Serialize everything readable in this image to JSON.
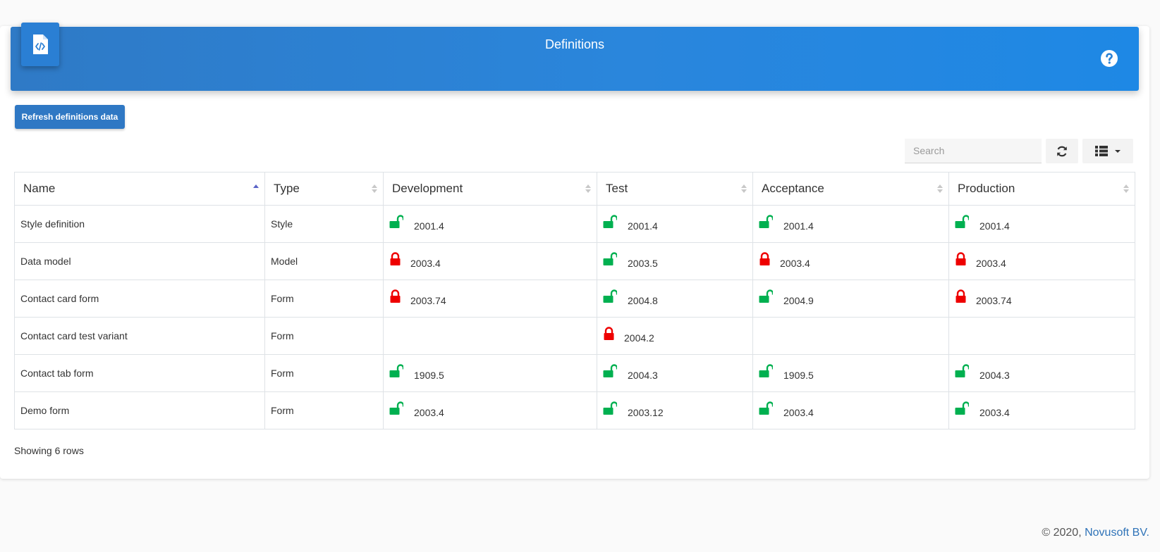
{
  "header": {
    "title": "Definitions",
    "app_icon": "code-file-icon",
    "help_icon": "question-circle-icon",
    "color_start": "#2f7ac6",
    "color_end": "#1e88e5"
  },
  "toolbar": {
    "refresh_button_label": "Refresh definitions data",
    "search_placeholder": "Search",
    "refresh_icon": "sync-icon",
    "columns_icon": "list-icon"
  },
  "table": {
    "columns": [
      {
        "label": "Name",
        "sort": "asc"
      },
      {
        "label": "Type",
        "sort": "none"
      },
      {
        "label": "Development",
        "sort": "none"
      },
      {
        "label": "Test",
        "sort": "none"
      },
      {
        "label": "Acceptance",
        "sort": "none"
      },
      {
        "label": "Production",
        "sort": "none"
      }
    ],
    "rows": [
      {
        "name": "Style definition",
        "type": "Style",
        "cells": [
          {
            "status": "unlocked",
            "version": "2001.4"
          },
          {
            "status": "unlocked",
            "version": "2001.4"
          },
          {
            "status": "unlocked",
            "version": "2001.4"
          },
          {
            "status": "unlocked",
            "version": "2001.4"
          }
        ]
      },
      {
        "name": "Data model",
        "type": "Model",
        "cells": [
          {
            "status": "locked",
            "version": "2003.4"
          },
          {
            "status": "unlocked",
            "version": "2003.5"
          },
          {
            "status": "locked",
            "version": "2003.4"
          },
          {
            "status": "locked",
            "version": "2003.4"
          }
        ]
      },
      {
        "name": "Contact card form",
        "type": "Form",
        "cells": [
          {
            "status": "locked",
            "version": "2003.74"
          },
          {
            "status": "unlocked",
            "version": "2004.8"
          },
          {
            "status": "unlocked",
            "version": "2004.9"
          },
          {
            "status": "locked",
            "version": "2003.74"
          }
        ]
      },
      {
        "name": "Contact card test variant",
        "type": "Form",
        "cells": [
          null,
          {
            "status": "locked",
            "version": "2004.2"
          },
          null,
          null
        ]
      },
      {
        "name": "Contact tab form",
        "type": "Form",
        "cells": [
          {
            "status": "unlocked",
            "version": "1909.5"
          },
          {
            "status": "unlocked",
            "version": "2004.3"
          },
          {
            "status": "unlocked",
            "version": "1909.5"
          },
          {
            "status": "unlocked",
            "version": "2004.3"
          }
        ]
      },
      {
        "name": "Demo form",
        "type": "Form",
        "cells": [
          {
            "status": "unlocked",
            "version": "2003.4"
          },
          {
            "status": "unlocked",
            "version": "2003.12"
          },
          {
            "status": "unlocked",
            "version": "2003.4"
          },
          {
            "status": "unlocked",
            "version": "2003.4"
          }
        ]
      }
    ],
    "footer_text": "Showing 6 rows"
  },
  "status_colors": {
    "unlocked": "#00b050",
    "locked": "#ee0000"
  },
  "footer": {
    "copyright": "© 2020, ",
    "company": "Novusoft BV."
  }
}
